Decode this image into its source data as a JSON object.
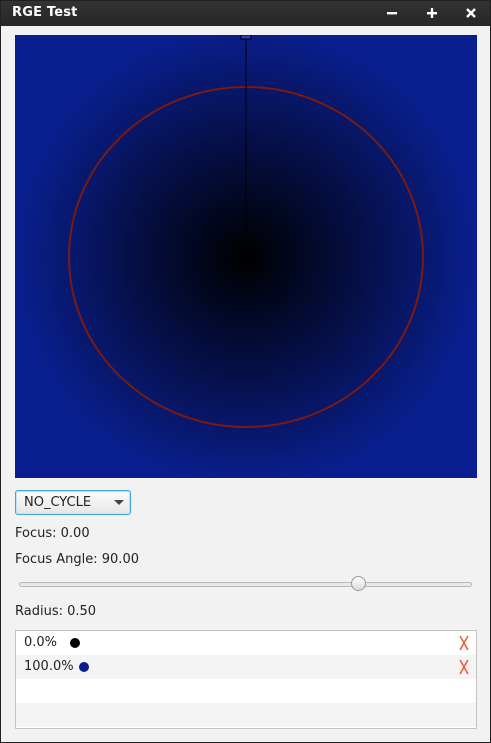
{
  "window": {
    "title": "RGE Test",
    "minimize_icon": "minimize-icon",
    "maximize_icon": "maximize-icon",
    "close_icon": "close-icon"
  },
  "gradient_preview": {
    "center_color": "#000000",
    "edge_color": "#0a1f8f",
    "ring_color": "#7a1a10",
    "handle_line_color": "#000000"
  },
  "cycle_dropdown": {
    "selected": "NO_CYCLE",
    "icon": "chevron-down-icon"
  },
  "focus_label": "Focus: 0.00",
  "focus_angle_label": "Focus Angle: 90.00",
  "focus_angle_slider": {
    "value_fraction": 0.75
  },
  "radius_label": "Radius: 0.50",
  "stops": [
    {
      "label": "0.0%",
      "color": "#000000",
      "delete_icon": "delete-icon"
    },
    {
      "label": "100.0%",
      "color": "#0a1f8f",
      "delete_icon": "delete-icon"
    }
  ],
  "colors": {
    "titlebar": "#2b2b2b",
    "delete_accent": "#e8603c",
    "focus_border": "#3ea6e6"
  }
}
